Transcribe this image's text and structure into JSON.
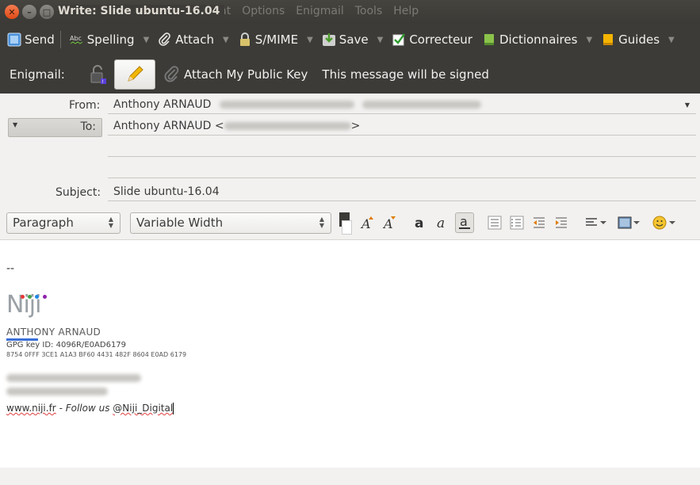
{
  "window": {
    "title": "Write: Slide ubuntu-16.04",
    "menu": [
      "rmat",
      "Options",
      "Enigmail",
      "Tools",
      "Help"
    ]
  },
  "toolbar": {
    "send": "Send",
    "spelling": "Spelling",
    "attach": "Attach",
    "smime": "S/MIME",
    "save": "Save",
    "correcteur": "Correcteur",
    "dictionnaires": "Dictionnaires",
    "guides": "Guides"
  },
  "enigmail": {
    "label": "Enigmail:",
    "attach_key": "Attach My Public Key",
    "status": "This message will be signed"
  },
  "headers": {
    "from_label": "From:",
    "from_value": "Anthony ARNAUD",
    "to_label": "To:",
    "to_value": "Anthony ARNAUD <",
    "to_close": ">",
    "subject_label": "Subject:",
    "subject_value": "Slide ubuntu-16.04"
  },
  "format": {
    "paragraph": "Paragraph",
    "font": "Variable Width"
  },
  "body": {
    "sig_dash": "--",
    "logo_text": "Niji",
    "name": "ANTHONY ARNAUD",
    "gpg": "GPG key ID: 4096R/E0AD6179",
    "fingerprint": "8754 0FFF 3CE1 A1A3 BF60 4431 482F 8604 E0AD 6179",
    "website": "www.niji.fr",
    "dash": " - ",
    "follow": "Follow us",
    "handle": "@Niji_Digital"
  },
  "colors": {
    "titlebar": "#3c3b37",
    "logo_dot_red": "#e53935",
    "logo_dot_green": "#43a047",
    "logo_dot_blue": "#1e88e5",
    "logo_dot_purple": "#8e24aa",
    "sig_bar": "#3a6fd8"
  }
}
